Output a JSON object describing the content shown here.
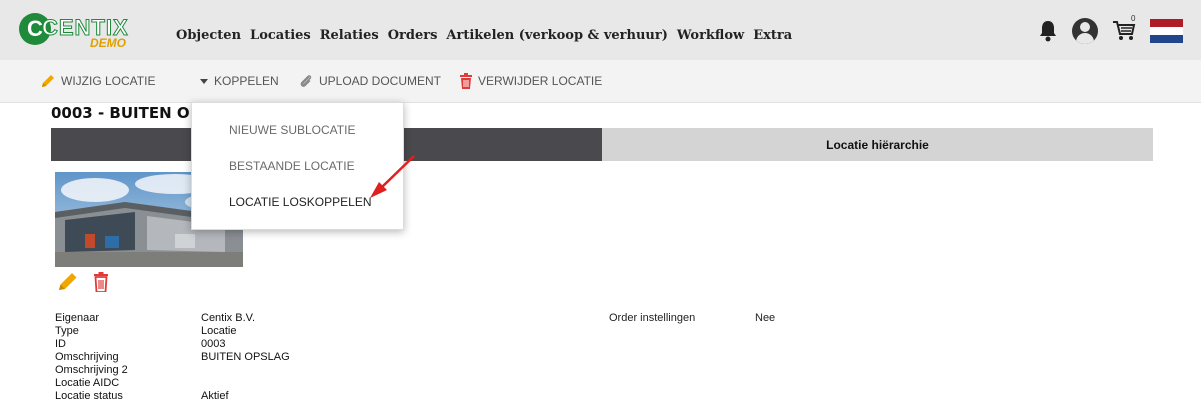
{
  "brand": {
    "name": "CENTIX",
    "letter": "C",
    "subtitle": "DEMO"
  },
  "nav": [
    "Objecten",
    "Locaties",
    "Relaties",
    "Orders",
    "Artikelen (verkoop & verhuur)",
    "Workflow",
    "Extra"
  ],
  "header_icons": {
    "notifications": "bell-icon",
    "account": "user-avatar-icon",
    "cart": "cart-icon",
    "cart_count": "0",
    "language": "dutch-flag-icon"
  },
  "colors": {
    "flag_red": "#ae1c28",
    "flag_white": "#ffffff",
    "flag_blue": "#21468b",
    "edit": "#f0a800",
    "delete": "#e03a3a",
    "brand": "#1f8a3a",
    "arrow": "#e02020"
  },
  "toolbar": {
    "edit_label": "WIJZIG LOCATIE",
    "link_label": "KOPPELEN",
    "upload_label": "UPLOAD DOCUMENT",
    "delete_label": "VERWIJDER LOCATIE"
  },
  "page_title": "0003 - BUITEN O",
  "tabs": {
    "first": "",
    "second": "Locatie hiërarchie"
  },
  "dropdown": [
    "NIEUWE SUBLOCATIE",
    "BESTAANDE LOCATIE",
    "LOCATIE LOSKOPPELEN"
  ],
  "details": [
    {
      "label": "Eigenaar",
      "value": "Centix B.V."
    },
    {
      "label": "Type",
      "value": "Locatie"
    },
    {
      "label": "ID",
      "value": "0003"
    },
    {
      "label": "Omschrijving",
      "value": "BUITEN OPSLAG"
    },
    {
      "label": "Omschrijving 2",
      "value": ""
    },
    {
      "label": "Locatie AIDC",
      "value": ""
    },
    {
      "label": "Locatie status",
      "value": "Aktief"
    }
  ],
  "order_settings": {
    "label": "Order instellingen",
    "value": "Nee"
  }
}
